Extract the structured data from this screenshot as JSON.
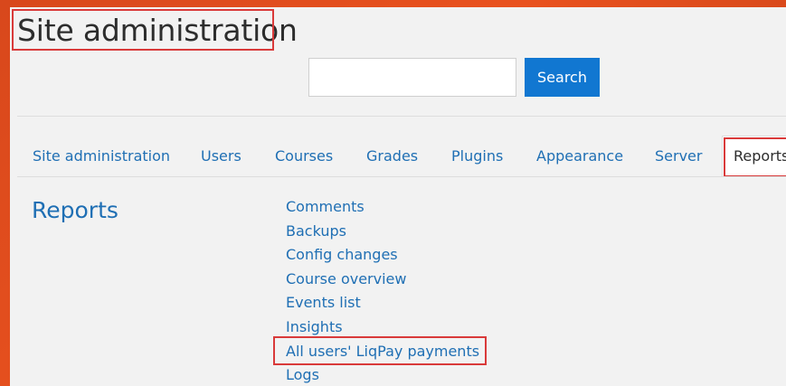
{
  "page": {
    "title": "Site administration"
  },
  "search": {
    "placeholder": "",
    "value": "",
    "button_label": "Search"
  },
  "tabs": [
    {
      "label": "Site administration"
    },
    {
      "label": "Users"
    },
    {
      "label": "Courses"
    },
    {
      "label": "Grades"
    },
    {
      "label": "Plugins"
    },
    {
      "label": "Appearance"
    },
    {
      "label": "Server"
    },
    {
      "label": "Reports",
      "active": true
    }
  ],
  "section": {
    "heading": "Reports",
    "links": [
      {
        "label": "Comments"
      },
      {
        "label": "Backups"
      },
      {
        "label": "Config changes"
      },
      {
        "label": "Course overview"
      },
      {
        "label": "Events list"
      },
      {
        "label": "Insights"
      },
      {
        "label": "All users' LiqPay payments",
        "highlighted": true
      },
      {
        "label": "Logs"
      }
    ]
  },
  "colors": {
    "background_orange": "#e9521f",
    "panel": "#f2f2f2",
    "link": "#1f6fb4",
    "primary_button": "#1177d1",
    "highlight_box": "#d93a3a",
    "title_text": "#2d2d2d"
  }
}
